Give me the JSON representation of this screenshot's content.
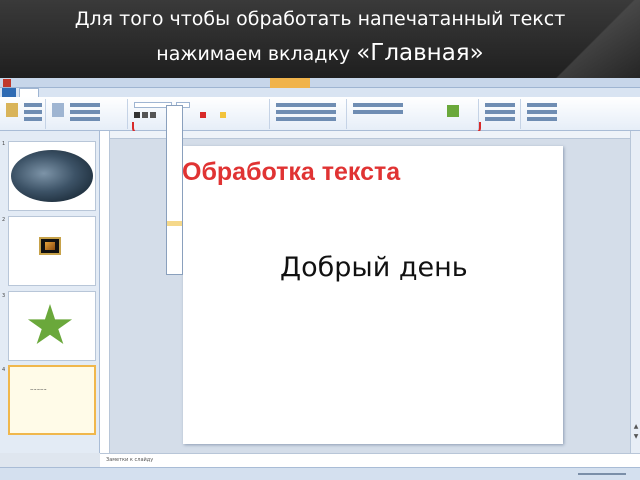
{
  "header": {
    "line1": "Для того чтобы обработать  напечатанный текст",
    "line2_prefix": "нажимаем вкладку ",
    "line2_emph": "«Главная»"
  },
  "caption": "Обработка текста",
  "slide_text": "Добрый день",
  "thumbs": [
    {
      "num": "1"
    },
    {
      "num": "2"
    },
    {
      "num": "3"
    },
    {
      "num": "4"
    }
  ],
  "notes_placeholder": "Заметки к слайду",
  "colors": {
    "accent": "#e03333",
    "brace": "#d82a2a"
  }
}
